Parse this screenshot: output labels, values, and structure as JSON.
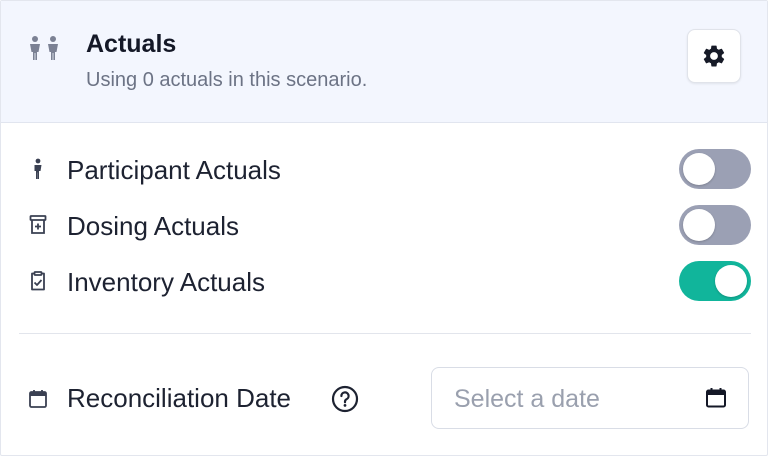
{
  "header": {
    "title": "Actuals",
    "subtitle": "Using 0 actuals in this scenario.",
    "icon": "people-icon",
    "settings_icon": "gear-icon"
  },
  "actuals": [
    {
      "label": "Participant Actuals",
      "icon": "person-icon",
      "enabled": false
    },
    {
      "label": "Dosing Actuals",
      "icon": "medicine-box-icon",
      "enabled": false
    },
    {
      "label": "Inventory Actuals",
      "icon": "clipboard-check-icon",
      "enabled": true
    }
  ],
  "reconciliation": {
    "label": "Reconciliation Date",
    "help_icon": "question-icon",
    "placeholder": "Select a date",
    "value": "",
    "calendar_icon": "calendar-icon"
  },
  "colors": {
    "header_bg": "#f3f6fe",
    "toggle_on": "#11b59b",
    "toggle_off": "#9ba0b4"
  }
}
